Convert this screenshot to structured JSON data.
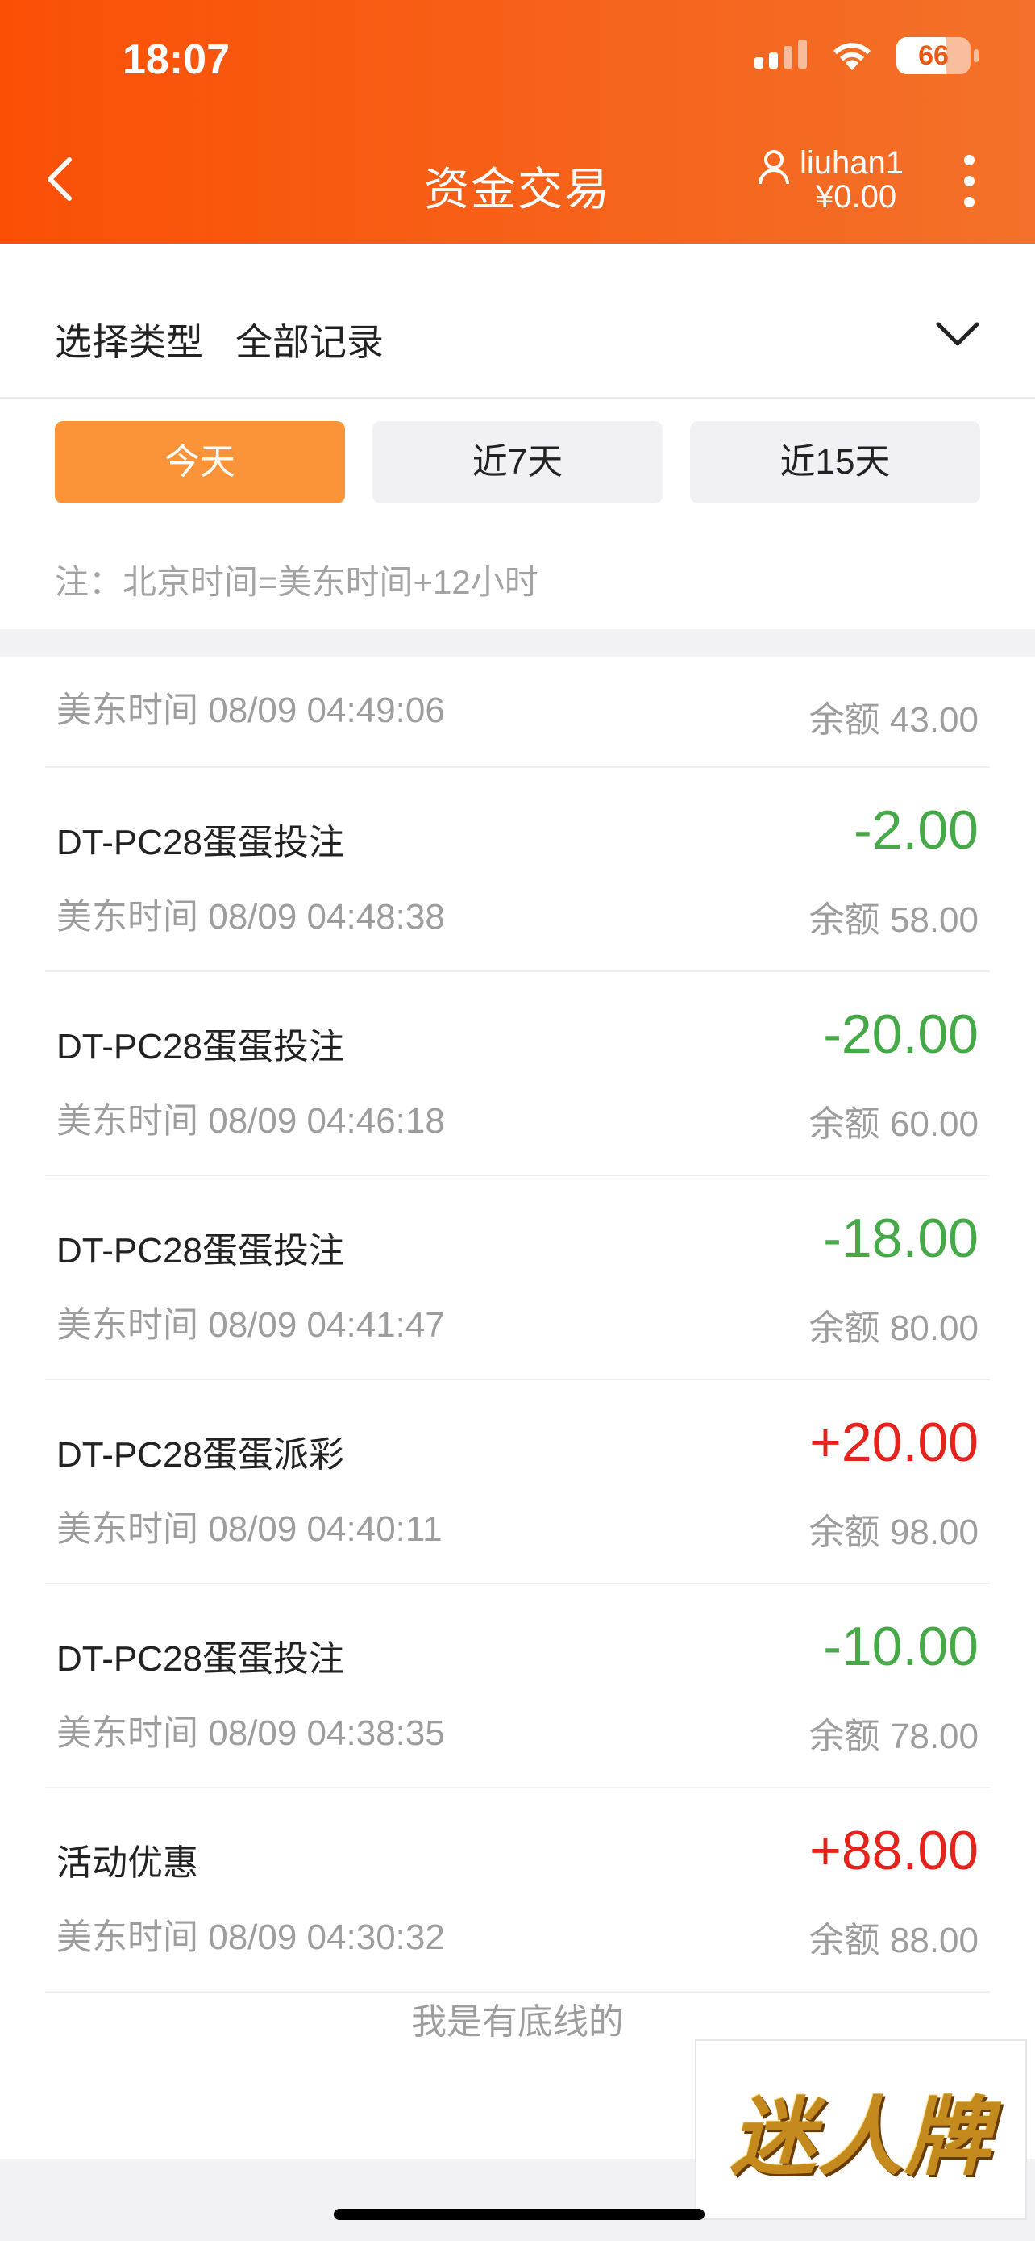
{
  "status": {
    "time": "18:07",
    "battery": "66"
  },
  "header": {
    "title": "资金交易",
    "username": "liuhan1",
    "balance": "¥0.00"
  },
  "filter": {
    "label": "选择类型",
    "value": "全部记录"
  },
  "ranges": [
    {
      "label": "今天",
      "active": true
    },
    {
      "label": "近7天"
    },
    {
      "label": "近15天"
    }
  ],
  "note": "注：北京时间=美东时间+12小时",
  "first_row": {
    "time": "美东时间 08/09 04:49:06",
    "balance": "余额 43.00"
  },
  "rows": [
    {
      "name": "DT-PC28蛋蛋投注",
      "time": "美东时间 08/09 04:48:38",
      "amount": "-2.00",
      "balance": "余额 58.00"
    },
    {
      "name": "DT-PC28蛋蛋投注",
      "time": "美东时间 08/09 04:46:18",
      "amount": "-20.00",
      "balance": "余额 60.00"
    },
    {
      "name": "DT-PC28蛋蛋投注",
      "time": "美东时间 08/09 04:41:47",
      "amount": "-18.00",
      "balance": "余额 80.00"
    },
    {
      "name": "DT-PC28蛋蛋派彩",
      "time": "美东时间 08/09 04:40:11",
      "amount": "+20.00",
      "balance": "余额 98.00"
    },
    {
      "name": "DT-PC28蛋蛋投注",
      "time": "美东时间 08/09 04:38:35",
      "amount": "-10.00",
      "balance": "余额 78.00"
    },
    {
      "name": "活动优惠",
      "time": "美东时间 08/09 04:30:32",
      "amount": "+88.00",
      "balance": "余额 88.00"
    }
  ],
  "footer": "我是有底线的",
  "logo": "迷人牌",
  "colors": {
    "header_start": "#fb4f06",
    "header_end": "#f3712a",
    "chip_active": "#fb9338",
    "negative": "#46a947",
    "positive": "#e4231c"
  }
}
